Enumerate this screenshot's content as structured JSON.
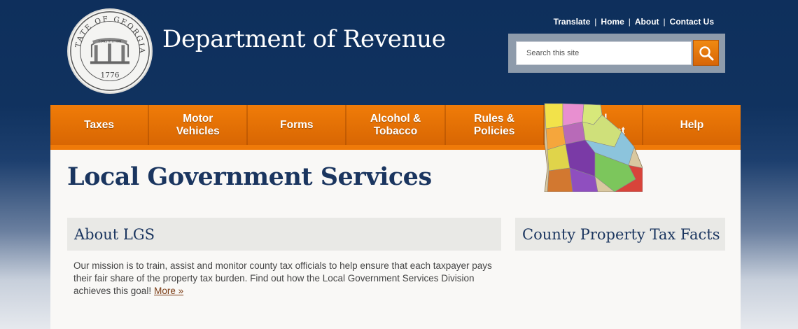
{
  "header": {
    "seal": {
      "top_text": "STATE OF GEORGIA",
      "ribbon_text": "CONSTITUTION",
      "year": "1776"
    },
    "site_title": "Department of Revenue",
    "util_links": [
      {
        "label": "Translate"
      },
      {
        "label": "Home"
      },
      {
        "label": "About"
      },
      {
        "label": "Contact Us"
      }
    ],
    "util_separator": "|",
    "search": {
      "placeholder": "Search this site",
      "value": ""
    }
  },
  "nav": {
    "items": [
      {
        "label": "Taxes"
      },
      {
        "label": "Motor\nVehicles"
      },
      {
        "label": "Forms"
      },
      {
        "label": "Alcohol &\nTobacco"
      },
      {
        "label": "Rules &\nPolicies"
      },
      {
        "label": "Local\nGovernment"
      },
      {
        "label": "Help"
      }
    ]
  },
  "main": {
    "page_title": "Local Government Services",
    "about": {
      "heading": "About LGS",
      "body": "Our mission is to train, assist and monitor county tax officials to help ensure that each taxpayer pays their fair share of the property tax burden.  Find out how the Local Government Services Division achieves this goal!",
      "more_label": "More »"
    },
    "facts": {
      "heading": "County Property Tax Facts"
    }
  },
  "colors": {
    "header_bg": "#10325f",
    "nav_orange": "#e8720a",
    "title_navy": "#1a355f",
    "search_button": "#e27511",
    "more_link": "#7a3a12"
  },
  "icons": {
    "search_button": "magnifier-icon",
    "seal": "georgia-seal-icon",
    "map": "georgia-county-map"
  }
}
